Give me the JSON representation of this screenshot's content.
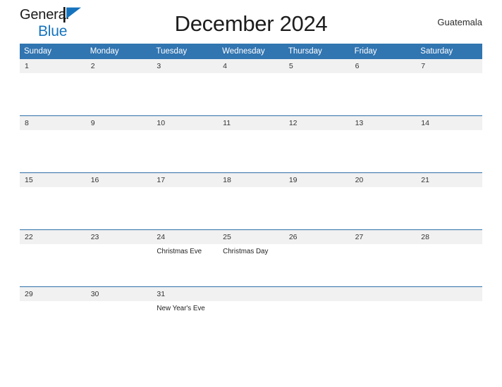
{
  "brand": {
    "name_line1": "General",
    "name_line2": "Blue",
    "flag_icon": "flag-icon"
  },
  "header": {
    "title": "December 2024",
    "country": "Guatemala"
  },
  "colors": {
    "header_blue": "#3175b1",
    "brand_blue": "#1573bd",
    "date_band_gray": "#f1f1f1",
    "row_divider": "#2f6fa8",
    "text_dark": "#1d1d1d"
  },
  "calendar": {
    "month": "December",
    "year": "2024",
    "weekdays": [
      "Sunday",
      "Monday",
      "Tuesday",
      "Wednesday",
      "Thursday",
      "Friday",
      "Saturday"
    ],
    "weeks": [
      {
        "days": [
          {
            "number": "1",
            "events": []
          },
          {
            "number": "2",
            "events": []
          },
          {
            "number": "3",
            "events": []
          },
          {
            "number": "4",
            "events": []
          },
          {
            "number": "5",
            "events": []
          },
          {
            "number": "6",
            "events": []
          },
          {
            "number": "7",
            "events": []
          }
        ]
      },
      {
        "days": [
          {
            "number": "8",
            "events": []
          },
          {
            "number": "9",
            "events": []
          },
          {
            "number": "10",
            "events": []
          },
          {
            "number": "11",
            "events": []
          },
          {
            "number": "12",
            "events": []
          },
          {
            "number": "13",
            "events": []
          },
          {
            "number": "14",
            "events": []
          }
        ]
      },
      {
        "days": [
          {
            "number": "15",
            "events": []
          },
          {
            "number": "16",
            "events": []
          },
          {
            "number": "17",
            "events": []
          },
          {
            "number": "18",
            "events": []
          },
          {
            "number": "19",
            "events": []
          },
          {
            "number": "20",
            "events": []
          },
          {
            "number": "21",
            "events": []
          }
        ]
      },
      {
        "days": [
          {
            "number": "22",
            "events": []
          },
          {
            "number": "23",
            "events": []
          },
          {
            "number": "24",
            "events": [
              "Christmas Eve"
            ]
          },
          {
            "number": "25",
            "events": [
              "Christmas Day"
            ]
          },
          {
            "number": "26",
            "events": []
          },
          {
            "number": "27",
            "events": []
          },
          {
            "number": "28",
            "events": []
          }
        ]
      },
      {
        "days": [
          {
            "number": "29",
            "events": []
          },
          {
            "number": "30",
            "events": []
          },
          {
            "number": "31",
            "events": [
              "New Year's Eve"
            ]
          },
          {
            "number": "",
            "events": []
          },
          {
            "number": "",
            "events": []
          },
          {
            "number": "",
            "events": []
          },
          {
            "number": "",
            "events": []
          }
        ]
      }
    ]
  }
}
